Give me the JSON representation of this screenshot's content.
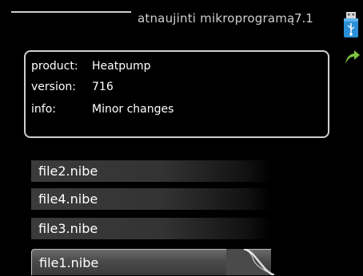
{
  "header": {
    "title": "atnaujinti mikroprogramą",
    "menu_number": "7.1"
  },
  "icons": {
    "usb": "usb-icon",
    "back": "back-arrow-icon"
  },
  "info": {
    "product_label": "product:",
    "product_value": "Heatpump",
    "version_label": "version:",
    "version_value": "716",
    "info_label": "info:",
    "info_value": "Minor changes"
  },
  "files": [
    {
      "name": "file2.nibe"
    },
    {
      "name": "file4.nibe"
    },
    {
      "name": "file3.nibe"
    },
    {
      "name": "file1.nibe",
      "selected": true
    }
  ],
  "colors": {
    "background": "#000000",
    "text": "#ffffff",
    "accent_green": "#7ec242",
    "usb_blue": "#2a8fd6"
  }
}
